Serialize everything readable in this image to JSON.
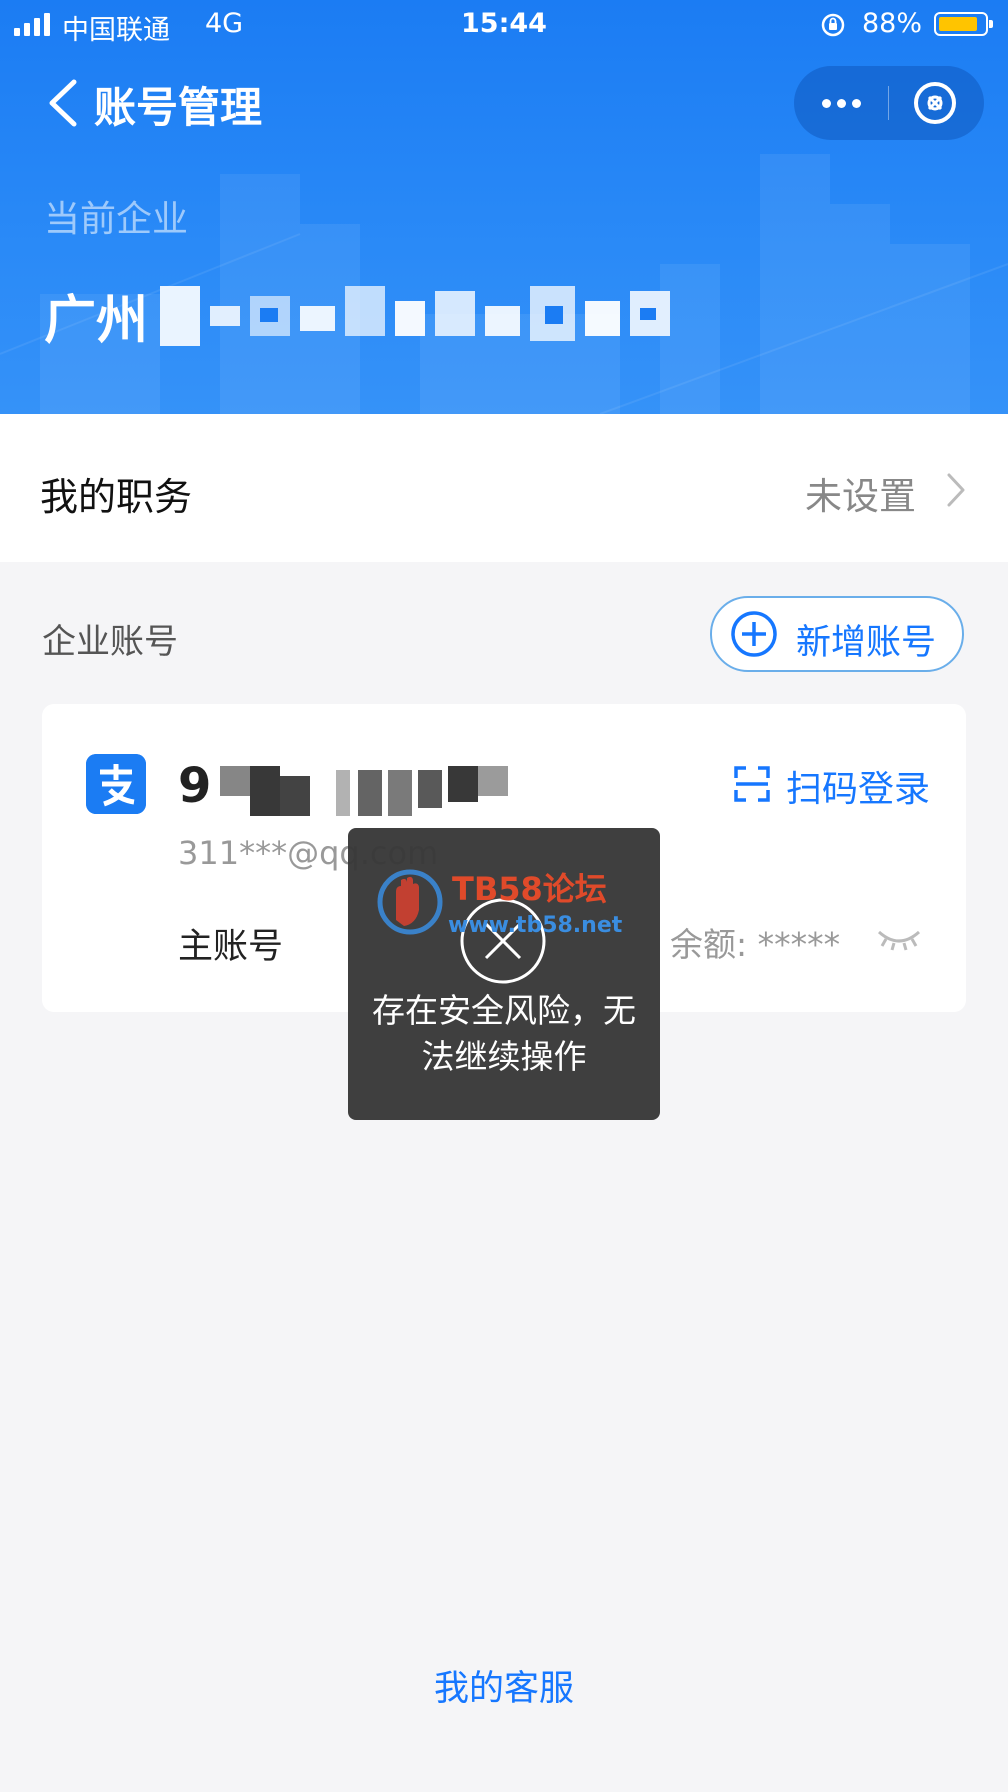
{
  "status_bar": {
    "carrier": "中国联通",
    "network": "4G",
    "time": "15:44",
    "battery_percent": "88%",
    "battery_color": "#ffc400"
  },
  "nav": {
    "back_icon": "chevron-left-icon",
    "title": "账号管理",
    "more_icon": "more-dots-icon",
    "close_icon": "close-circle-icon"
  },
  "company": {
    "label": "当前企业",
    "name_visible": "广州"
  },
  "job": {
    "label": "我的职务",
    "value": "未设置"
  },
  "accounts": {
    "section_label": "企业账号",
    "add_button_label": "新增账号",
    "items": [
      {
        "name_visible": "9",
        "email": "311***@qq.com",
        "type": "主账号",
        "balance": "余额: *****",
        "scan_login_label": "扫码登录"
      }
    ]
  },
  "toast": {
    "message": "存在安全风险，无法继续操作",
    "icon": "close-circle-icon"
  },
  "watermark": {
    "title": "TB58论坛",
    "url": "www.tb58.net"
  },
  "footer": {
    "service_link": "我的客服"
  },
  "colors": {
    "header_blue": "#1b7cf3",
    "accent_blue": "#1677ff",
    "background": "#f5f5f7"
  }
}
